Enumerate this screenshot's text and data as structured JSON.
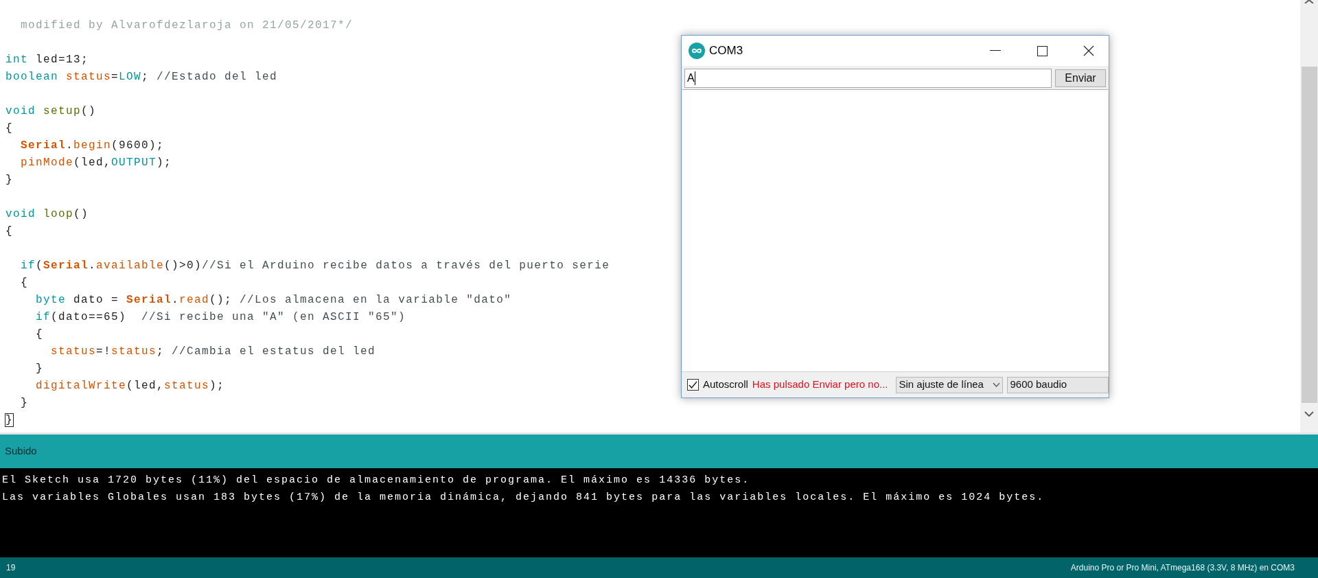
{
  "editor": {
    "lines": [
      {
        "blank_before": false,
        "tokens": [
          {
            "kind": "doc",
            "text": "  modified by Alvarofdezlaroja on 21/05/2017*/"
          }
        ]
      },
      {
        "blank_before": true,
        "tokens": [
          {
            "kind": "keyword",
            "text": "int"
          },
          {
            "kind": "text",
            "text": " led=13;"
          }
        ]
      },
      {
        "blank_before": false,
        "tokens": [
          {
            "kind": "keyword",
            "text": "boolean "
          },
          {
            "kind": "function",
            "text": "status"
          },
          {
            "kind": "text",
            "text": "="
          },
          {
            "kind": "keyword",
            "text": "LOW"
          },
          {
            "kind": "text",
            "text": "; "
          },
          {
            "kind": "comment",
            "text": "//Estado del led"
          }
        ]
      },
      {
        "blank_before": true,
        "tokens": [
          {
            "kind": "keyword",
            "text": "void "
          },
          {
            "kind": "structure",
            "text": "setup"
          },
          {
            "kind": "text",
            "text": "()"
          }
        ]
      },
      {
        "blank_before": false,
        "tokens": [
          {
            "kind": "text",
            "text": "{"
          }
        ]
      },
      {
        "blank_before": false,
        "tokens": [
          {
            "kind": "class",
            "text": "  Serial"
          },
          {
            "kind": "text",
            "text": "."
          },
          {
            "kind": "function",
            "text": "begin"
          },
          {
            "kind": "text",
            "text": "(9600);"
          }
        ]
      },
      {
        "blank_before": false,
        "tokens": [
          {
            "kind": "function",
            "text": "  pinMode"
          },
          {
            "kind": "text",
            "text": "(led,"
          },
          {
            "kind": "keyword",
            "text": "OUTPUT"
          },
          {
            "kind": "text",
            "text": ");"
          }
        ]
      },
      {
        "blank_before": false,
        "tokens": [
          {
            "kind": "text",
            "text": "}"
          }
        ]
      },
      {
        "blank_before": true,
        "tokens": [
          {
            "kind": "keyword",
            "text": "void "
          },
          {
            "kind": "structure",
            "text": "loop"
          },
          {
            "kind": "text",
            "text": "()"
          }
        ]
      },
      {
        "blank_before": false,
        "tokens": [
          {
            "kind": "text",
            "text": "{"
          }
        ]
      },
      {
        "blank_before": true,
        "tokens": [
          {
            "kind": "keyword",
            "text": "  if"
          },
          {
            "kind": "text",
            "text": "("
          },
          {
            "kind": "class",
            "text": "Serial"
          },
          {
            "kind": "text",
            "text": "."
          },
          {
            "kind": "function",
            "text": "available"
          },
          {
            "kind": "text",
            "text": "()>0)"
          },
          {
            "kind": "comment",
            "text": "//Si el Arduino recibe datos a través del puerto serie"
          }
        ]
      },
      {
        "blank_before": false,
        "tokens": [
          {
            "kind": "text",
            "text": "  {"
          }
        ]
      },
      {
        "blank_before": false,
        "tokens": [
          {
            "kind": "keyword",
            "text": "    byte"
          },
          {
            "kind": "text",
            "text": " dato = "
          },
          {
            "kind": "class",
            "text": "Serial"
          },
          {
            "kind": "text",
            "text": "."
          },
          {
            "kind": "function",
            "text": "read"
          },
          {
            "kind": "text",
            "text": "(); "
          },
          {
            "kind": "comment",
            "text": "//Los almacena en la variable \"dato\""
          }
        ]
      },
      {
        "blank_before": false,
        "tokens": [
          {
            "kind": "keyword",
            "text": "    if"
          },
          {
            "kind": "text",
            "text": "(dato==65)  "
          },
          {
            "kind": "comment",
            "text": "//Si recibe una \"A\" (en ASCII \"65\")"
          }
        ]
      },
      {
        "blank_before": false,
        "tokens": [
          {
            "kind": "text",
            "text": "    {"
          }
        ]
      },
      {
        "blank_before": false,
        "tokens": [
          {
            "kind": "function",
            "text": "      status"
          },
          {
            "kind": "text",
            "text": "=!"
          },
          {
            "kind": "function",
            "text": "status"
          },
          {
            "kind": "text",
            "text": "; "
          },
          {
            "kind": "comment",
            "text": "//Cambia el estatus del led"
          }
        ]
      },
      {
        "blank_before": false,
        "tokens": [
          {
            "kind": "text",
            "text": "    }"
          }
        ]
      },
      {
        "blank_before": false,
        "tokens": [
          {
            "kind": "function",
            "text": "    digitalWrite"
          },
          {
            "kind": "text",
            "text": "(led,"
          },
          {
            "kind": "function",
            "text": "status"
          },
          {
            "kind": "text",
            "text": ");"
          }
        ]
      },
      {
        "blank_before": false,
        "tokens": [
          {
            "kind": "text",
            "text": "  }"
          }
        ]
      },
      {
        "blank_before": false,
        "tokens": [
          {
            "kind": "bracket",
            "text": "}"
          }
        ]
      }
    ]
  },
  "serial_monitor": {
    "title": "COM3",
    "input": {
      "value": "A"
    },
    "send_button": "Enviar",
    "autoscroll": {
      "label": "Autoscroll",
      "checked": true
    },
    "warning": "Has pulsado Enviar pero no...",
    "line_ending": "Sin ajuste de línea",
    "baud_rate": "9600 baudio"
  },
  "console": {
    "header": "Subido",
    "lines": [
      "El Sketch usa 1720 bytes (11%) del espacio de almacenamiento de programa. El máximo es 14336 bytes.",
      "Las variables Globales usan 183 bytes (17%) de la memoria dinámica, dejando 841 bytes para las variables locales. El máximo es 1024 bytes."
    ]
  },
  "status_bar": {
    "line": "19",
    "board": "Arduino Pro or Pro Mini, ATmega168 (3.3V, 8 MHz) en COM3"
  }
}
